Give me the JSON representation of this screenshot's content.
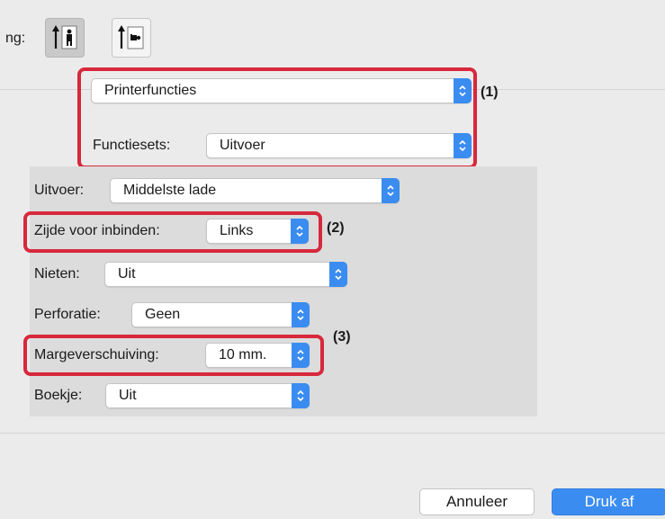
{
  "orientation": {
    "label": "ng:",
    "options": [
      {
        "icon": "portrait-orientation-icon",
        "selected": true
      },
      {
        "icon": "landscape-orientation-icon",
        "selected": false
      }
    ]
  },
  "section_menu": {
    "value": "Printerfuncties",
    "callout": "(1)"
  },
  "feature_sets": {
    "label": "Functiesets:",
    "value": "Uitvoer"
  },
  "settings": {
    "output": {
      "label": "Uitvoer:",
      "value": "Middelste lade"
    },
    "binding_edge": {
      "label": "Zijde voor inbinden:",
      "value": "Links",
      "callout": "(2)"
    },
    "staple": {
      "label": "Nieten:",
      "value": "Uit"
    },
    "punch": {
      "label": "Perforatie:",
      "value": "Geen"
    },
    "margin_shift": {
      "label": "Margeverschuiving:",
      "value": "10 mm.",
      "callout": "(3)"
    },
    "booklet": {
      "label": "Boekje:",
      "value": "Uit"
    }
  },
  "actions": {
    "cancel": "Annuleer",
    "print": "Druk af"
  },
  "colors": {
    "accent": "#3b8cf0",
    "highlight": "#d7283c"
  }
}
